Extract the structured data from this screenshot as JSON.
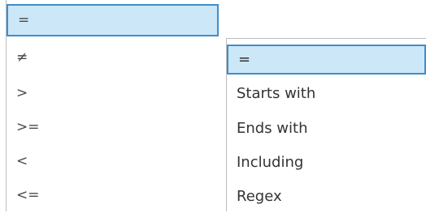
{
  "left_dropdown": {
    "items": [
      {
        "label": "=",
        "selected": true
      },
      {
        "label": "≠",
        "selected": false
      },
      {
        "label": ">",
        "selected": false
      },
      {
        "label": ">=",
        "selected": false
      },
      {
        "label": "<",
        "selected": false
      },
      {
        "label": "<=",
        "selected": false
      }
    ]
  },
  "right_dropdown": {
    "items": [
      {
        "label": "=",
        "selected": true
      },
      {
        "label": "Starts with",
        "selected": false
      },
      {
        "label": "Ends with",
        "selected": false
      },
      {
        "label": "Including",
        "selected": false
      },
      {
        "label": "Regex",
        "selected": false
      }
    ]
  },
  "colors": {
    "selected_background": "#cce7f8",
    "selected_border": "#3e8ecb",
    "text": "#333333"
  }
}
